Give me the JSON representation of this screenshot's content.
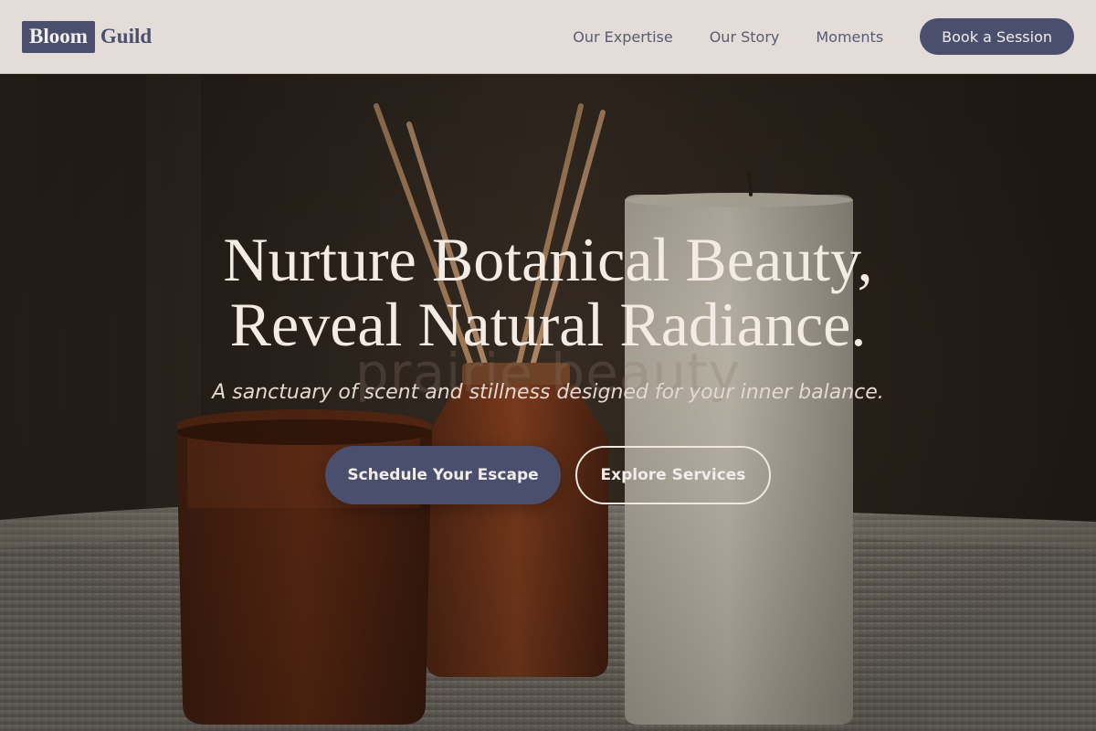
{
  "header": {
    "logo_box": "Bloom",
    "logo_text": "Guild",
    "nav": [
      {
        "label": "Our Expertise"
      },
      {
        "label": "Our Story"
      },
      {
        "label": "Moments"
      }
    ],
    "book_button": "Book a Session"
  },
  "hero": {
    "headline_line1": "Nurture Botanical Beauty,",
    "headline_line2": "Reveal Natural Radiance.",
    "watermark": "prairie beauty",
    "subtitle": "A sanctuary of scent and stillness designed for your inner balance.",
    "primary_cta": "Schedule Your Escape",
    "secondary_cta": "Explore Services"
  },
  "colors": {
    "accent": "#4b4f6e",
    "header_bg": "#e4dcd8",
    "headline": "#f3ebe4"
  }
}
